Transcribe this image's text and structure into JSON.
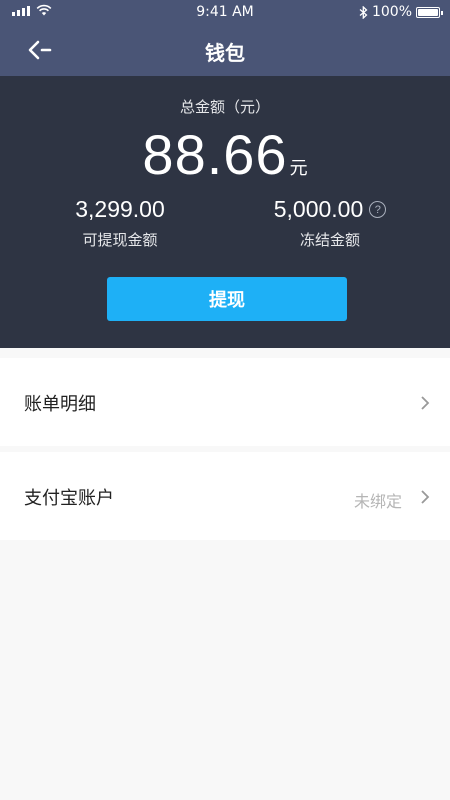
{
  "status_bar": {
    "time": "9:41 AM",
    "battery": "100%"
  },
  "nav": {
    "title": "钱包",
    "back_icon": "back-arrow-icon"
  },
  "wallet": {
    "total_label": "总金额（元）",
    "total_amount": "88.66",
    "total_unit": "元",
    "withdrawable_amount": "3,299.00",
    "withdrawable_label": "可提现金额",
    "frozen_amount": "5,000.00",
    "frozen_label": "冻结金额",
    "help_icon": "?",
    "withdraw_button": "提现"
  },
  "list": {
    "bills": {
      "label": "账单明细"
    },
    "alipay": {
      "label": "支付宝账户",
      "value": "未绑定"
    }
  },
  "colors": {
    "nav_bg": "#4a5576",
    "card_bg": "#2e3443",
    "accent": "#1eb0f6",
    "page_bg": "#f8f8f8"
  }
}
